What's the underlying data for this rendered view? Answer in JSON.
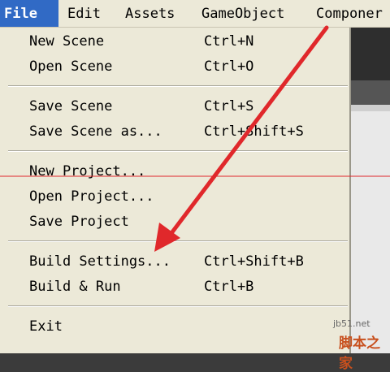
{
  "menubar": {
    "items": [
      "File",
      "Edit",
      "Assets",
      "GameObject",
      "Componer"
    ]
  },
  "file_menu": {
    "items": [
      {
        "label": "New Scene",
        "shortcut": "Ctrl+N"
      },
      {
        "label": "Open Scene",
        "shortcut": "Ctrl+O"
      },
      {
        "label": "Save Scene",
        "shortcut": "Ctrl+S"
      },
      {
        "label": "Save Scene as...",
        "shortcut": "Ctrl+Shift+S"
      },
      {
        "label": "New Project...",
        "shortcut": ""
      },
      {
        "label": "Open Project...",
        "shortcut": ""
      },
      {
        "label": "Save Project",
        "shortcut": ""
      },
      {
        "label": "Build Settings...",
        "shortcut": "Ctrl+Shift+B"
      },
      {
        "label": "Build & Run",
        "shortcut": "Ctrl+B"
      },
      {
        "label": "Exit",
        "shortcut": ""
      }
    ]
  },
  "watermark": {
    "url": "jb51.net",
    "site": "脚本之家"
  },
  "colors": {
    "menu_bg": "#ece9d8",
    "highlight": "#316ac5",
    "annotation_red": "#e0282b"
  },
  "icons": [
    "red-arrow-annotation-icon"
  ]
}
